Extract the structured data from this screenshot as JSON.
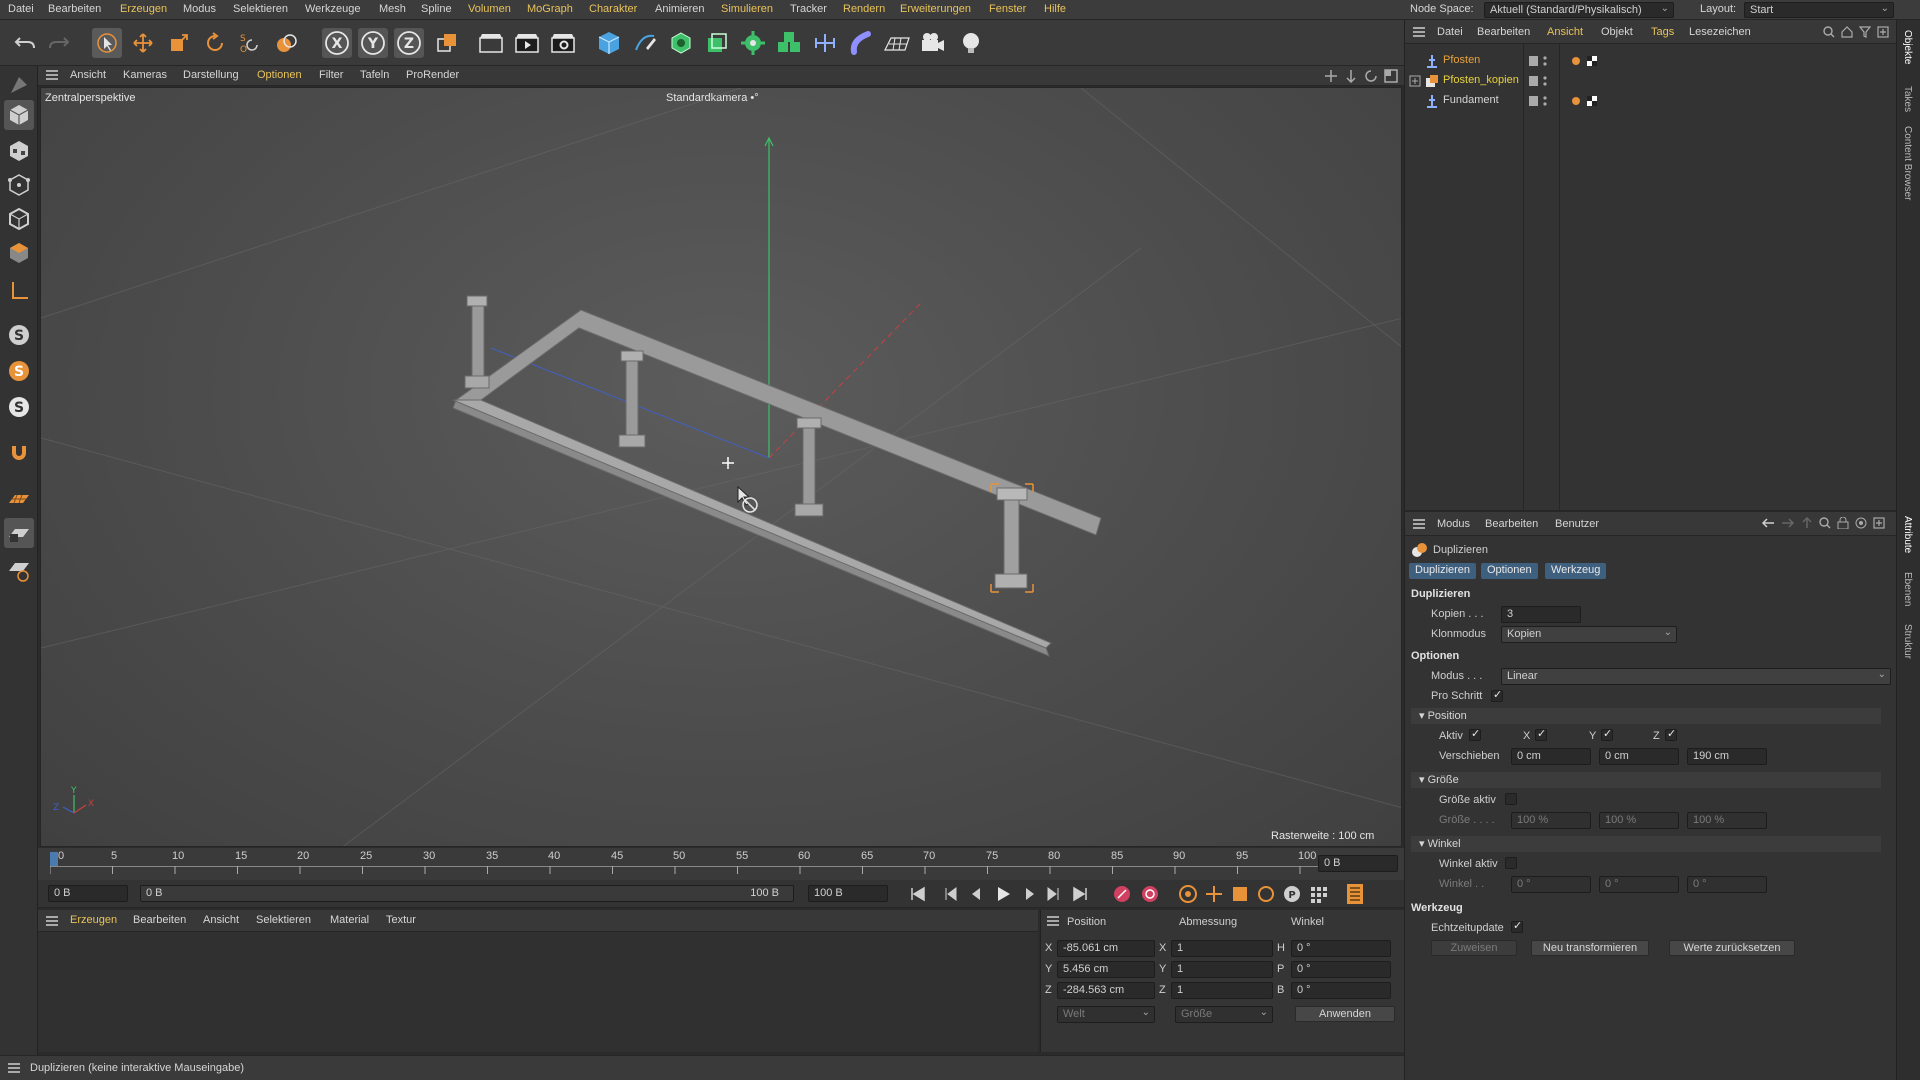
{
  "menubar": {
    "items": [
      "Datei",
      "Bearbeiten",
      "Erzeugen",
      "Modus",
      "Selektieren",
      "Werkzeuge",
      "Mesh",
      "Spline",
      "Volumen",
      "MoGraph",
      "Charakter",
      "Animieren",
      "Simulieren",
      "Tracker",
      "Rendern",
      "Erweiterungen",
      "Fenster",
      "Hilfe"
    ],
    "node_space_label": "Node Space:",
    "node_space_value": "Aktuell (Standard/Physikalisch)",
    "layout_label": "Layout:",
    "layout_value": "Start"
  },
  "toolbar": {
    "axis_x": "X",
    "axis_y": "Y",
    "axis_z": "Z"
  },
  "viewport_menu": {
    "items": [
      "Ansicht",
      "Kameras",
      "Darstellung",
      "Optionen",
      "Filter",
      "Tafeln",
      "ProRender"
    ]
  },
  "viewport": {
    "perspective_label": "Zentralperspektive",
    "camera_label": "Standardkamera •°",
    "grid_spacing": "Rasterweite : 100 cm",
    "axis_y": "Y",
    "axis_z": "Z",
    "axis_x": "X"
  },
  "timeline": {
    "ticks": [
      "0",
      "5",
      "10",
      "15",
      "20",
      "25",
      "30",
      "35",
      "40",
      "45",
      "50",
      "55",
      "60",
      "65",
      "70",
      "75",
      "80",
      "85",
      "90",
      "95",
      "100"
    ],
    "current_frame": "0 B"
  },
  "timeline_controls": {
    "start": "0 B",
    "range_start": "0 B",
    "range_end": "100 B",
    "end": "100 B"
  },
  "material_menu": {
    "items": [
      "Erzeugen",
      "Bearbeiten",
      "Ansicht",
      "Selektieren",
      "Material",
      "Textur"
    ]
  },
  "coords": {
    "headers": [
      "Position",
      "Abmessung",
      "Winkel"
    ],
    "rows": [
      {
        "axis": "X",
        "pos": "-85.061 cm",
        "size_axis": "X",
        "size": "1",
        "rot_axis": "H",
        "rot": "0 °"
      },
      {
        "axis": "Y",
        "pos": "5.456 cm",
        "size_axis": "Y",
        "size": "1",
        "rot_axis": "P",
        "rot": "0 °"
      },
      {
        "axis": "Z",
        "pos": "-284.563 cm",
        "size_axis": "Z",
        "size": "1",
        "rot_axis": "B",
        "rot": "0 °"
      }
    ],
    "mode_select": "Welt",
    "size_select": "Größe",
    "apply_label": "Anwenden"
  },
  "status": {
    "text": "Duplizieren (keine interaktive Mauseingabe)"
  },
  "object_manager": {
    "menu": [
      "Datei",
      "Bearbeiten",
      "Ansicht",
      "Objekt",
      "Tags",
      "Lesezeichen"
    ],
    "objects": [
      {
        "name": "Pfosten",
        "color": "#e8a23a"
      },
      {
        "name": "Pfosten_kopien",
        "color": "#e8d23a"
      },
      {
        "name": "Fundament",
        "color": "#d6d6d6"
      }
    ]
  },
  "side_tabs": {
    "top": [
      "Objekte",
      "Takes",
      "Content Browser"
    ],
    "bottom": [
      "Attribute",
      "Ebenen",
      "Struktur"
    ]
  },
  "attributes": {
    "menu": [
      "Modus",
      "Bearbeiten",
      "Benutzer"
    ],
    "object_title": "Duplizieren",
    "tabs": [
      "Duplizieren",
      "Optionen",
      "Werkzeug"
    ],
    "sec_duplizieren": "Duplizieren",
    "kopien_label": "Kopien . . .",
    "kopien_value": "3",
    "klonmodus_label": "Klonmodus",
    "klonmodus_value": "Kopien",
    "sec_optionen": "Optionen",
    "modus_label": "Modus . . .",
    "modus_value": "Linear",
    "pro_schritt_label": "Pro Schritt",
    "position_hdr": "Position",
    "aktiv_label": "Aktiv",
    "x_label": "X",
    "y_label": "Y",
    "z_label": "Z",
    "verschieben_label": "Verschieben",
    "verschieben_x": "0 cm",
    "verschieben_y": "0 cm",
    "verschieben_z": "190 cm",
    "groesse_hdr": "Größe",
    "groesse_aktiv_label": "Größe aktiv",
    "groesse_label": "Größe . . . .",
    "groesse_x": "100 %",
    "groesse_y": "100 %",
    "groesse_z": "100 %",
    "winkel_hdr": "Winkel",
    "winkel_aktiv_label": "Winkel aktiv",
    "winkel_label": "Winkel . .",
    "winkel_x": "0 °",
    "winkel_y": "0 °",
    "winkel_z": "0 °",
    "sec_werkzeug": "Werkzeug",
    "echtzeit_label": "Echtzeitupdate",
    "btn_zuweisen": "Zuweisen",
    "btn_neu": "Neu transformieren",
    "btn_reset": "Werte zurücksetzen"
  },
  "colors": {
    "accent_yellow": "#e8c25a",
    "selection_orange": "#e8923a",
    "tab_blue": "#3f5f7f",
    "y_axis_green": "#3ec06a",
    "x_axis_red": "#c84040",
    "z_axis_blue": "#4060c8"
  }
}
